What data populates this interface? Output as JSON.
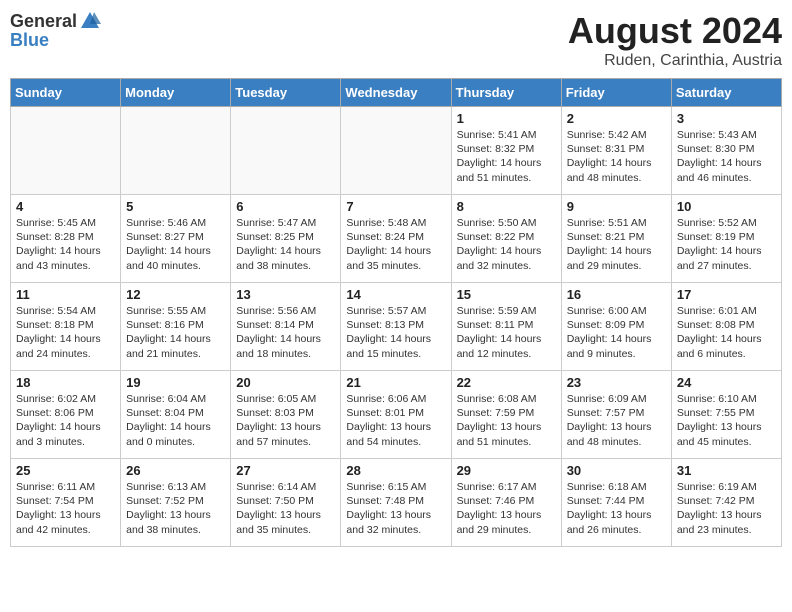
{
  "logo": {
    "general": "General",
    "blue": "Blue"
  },
  "header": {
    "title": "August 2024",
    "subtitle": "Ruden, Carinthia, Austria"
  },
  "weekdays": [
    "Sunday",
    "Monday",
    "Tuesday",
    "Wednesday",
    "Thursday",
    "Friday",
    "Saturday"
  ],
  "weeks": [
    [
      {
        "num": "",
        "info": ""
      },
      {
        "num": "",
        "info": ""
      },
      {
        "num": "",
        "info": ""
      },
      {
        "num": "",
        "info": ""
      },
      {
        "num": "1",
        "info": "Sunrise: 5:41 AM\nSunset: 8:32 PM\nDaylight: 14 hours\nand 51 minutes."
      },
      {
        "num": "2",
        "info": "Sunrise: 5:42 AM\nSunset: 8:31 PM\nDaylight: 14 hours\nand 48 minutes."
      },
      {
        "num": "3",
        "info": "Sunrise: 5:43 AM\nSunset: 8:30 PM\nDaylight: 14 hours\nand 46 minutes."
      }
    ],
    [
      {
        "num": "4",
        "info": "Sunrise: 5:45 AM\nSunset: 8:28 PM\nDaylight: 14 hours\nand 43 minutes."
      },
      {
        "num": "5",
        "info": "Sunrise: 5:46 AM\nSunset: 8:27 PM\nDaylight: 14 hours\nand 40 minutes."
      },
      {
        "num": "6",
        "info": "Sunrise: 5:47 AM\nSunset: 8:25 PM\nDaylight: 14 hours\nand 38 minutes."
      },
      {
        "num": "7",
        "info": "Sunrise: 5:48 AM\nSunset: 8:24 PM\nDaylight: 14 hours\nand 35 minutes."
      },
      {
        "num": "8",
        "info": "Sunrise: 5:50 AM\nSunset: 8:22 PM\nDaylight: 14 hours\nand 32 minutes."
      },
      {
        "num": "9",
        "info": "Sunrise: 5:51 AM\nSunset: 8:21 PM\nDaylight: 14 hours\nand 29 minutes."
      },
      {
        "num": "10",
        "info": "Sunrise: 5:52 AM\nSunset: 8:19 PM\nDaylight: 14 hours\nand 27 minutes."
      }
    ],
    [
      {
        "num": "11",
        "info": "Sunrise: 5:54 AM\nSunset: 8:18 PM\nDaylight: 14 hours\nand 24 minutes."
      },
      {
        "num": "12",
        "info": "Sunrise: 5:55 AM\nSunset: 8:16 PM\nDaylight: 14 hours\nand 21 minutes."
      },
      {
        "num": "13",
        "info": "Sunrise: 5:56 AM\nSunset: 8:14 PM\nDaylight: 14 hours\nand 18 minutes."
      },
      {
        "num": "14",
        "info": "Sunrise: 5:57 AM\nSunset: 8:13 PM\nDaylight: 14 hours\nand 15 minutes."
      },
      {
        "num": "15",
        "info": "Sunrise: 5:59 AM\nSunset: 8:11 PM\nDaylight: 14 hours\nand 12 minutes."
      },
      {
        "num": "16",
        "info": "Sunrise: 6:00 AM\nSunset: 8:09 PM\nDaylight: 14 hours\nand 9 minutes."
      },
      {
        "num": "17",
        "info": "Sunrise: 6:01 AM\nSunset: 8:08 PM\nDaylight: 14 hours\nand 6 minutes."
      }
    ],
    [
      {
        "num": "18",
        "info": "Sunrise: 6:02 AM\nSunset: 8:06 PM\nDaylight: 14 hours\nand 3 minutes."
      },
      {
        "num": "19",
        "info": "Sunrise: 6:04 AM\nSunset: 8:04 PM\nDaylight: 14 hours\nand 0 minutes."
      },
      {
        "num": "20",
        "info": "Sunrise: 6:05 AM\nSunset: 8:03 PM\nDaylight: 13 hours\nand 57 minutes."
      },
      {
        "num": "21",
        "info": "Sunrise: 6:06 AM\nSunset: 8:01 PM\nDaylight: 13 hours\nand 54 minutes."
      },
      {
        "num": "22",
        "info": "Sunrise: 6:08 AM\nSunset: 7:59 PM\nDaylight: 13 hours\nand 51 minutes."
      },
      {
        "num": "23",
        "info": "Sunrise: 6:09 AM\nSunset: 7:57 PM\nDaylight: 13 hours\nand 48 minutes."
      },
      {
        "num": "24",
        "info": "Sunrise: 6:10 AM\nSunset: 7:55 PM\nDaylight: 13 hours\nand 45 minutes."
      }
    ],
    [
      {
        "num": "25",
        "info": "Sunrise: 6:11 AM\nSunset: 7:54 PM\nDaylight: 13 hours\nand 42 minutes."
      },
      {
        "num": "26",
        "info": "Sunrise: 6:13 AM\nSunset: 7:52 PM\nDaylight: 13 hours\nand 38 minutes."
      },
      {
        "num": "27",
        "info": "Sunrise: 6:14 AM\nSunset: 7:50 PM\nDaylight: 13 hours\nand 35 minutes."
      },
      {
        "num": "28",
        "info": "Sunrise: 6:15 AM\nSunset: 7:48 PM\nDaylight: 13 hours\nand 32 minutes."
      },
      {
        "num": "29",
        "info": "Sunrise: 6:17 AM\nSunset: 7:46 PM\nDaylight: 13 hours\nand 29 minutes."
      },
      {
        "num": "30",
        "info": "Sunrise: 6:18 AM\nSunset: 7:44 PM\nDaylight: 13 hours\nand 26 minutes."
      },
      {
        "num": "31",
        "info": "Sunrise: 6:19 AM\nSunset: 7:42 PM\nDaylight: 13 hours\nand 23 minutes."
      }
    ]
  ]
}
